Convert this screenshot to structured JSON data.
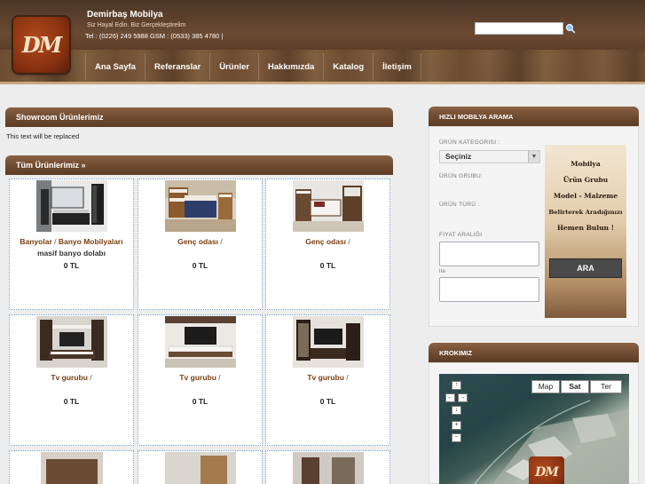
{
  "header": {
    "brand": "Demirbaş Mobilya",
    "slogan": "Siz Hayal Edin. Biz Gerçekleştirelim",
    "contact": "Tel : (0226) 249 5988 GSM : (0533) 385 4780 |",
    "logo_text": "DM",
    "search_placeholder": "",
    "search_icon": "search-icon"
  },
  "nav": [
    "Ana Sayfa",
    "Referanslar",
    "Ürünler",
    "Hakkımızda",
    "Katalog",
    "İletişim"
  ],
  "showroom": {
    "title": "Showroom Ürünlerimiz",
    "placeholder_text": "This text will be replaced"
  },
  "all_products": {
    "title": "Tüm Ürünlerimiz  »",
    "items": [
      {
        "title": "Banyolar",
        "category": "Banyo Mobilyaları",
        "subtitle": "masif banyo dolabı",
        "price": "0 TL"
      },
      {
        "title": "Genç odası",
        "category": "",
        "subtitle": "",
        "price": "0 TL"
      },
      {
        "title": "Genç odası",
        "category": "",
        "subtitle": "",
        "price": "0 TL"
      },
      {
        "title": "Tv gurubu",
        "category": "",
        "subtitle": "",
        "price": "0 TL"
      },
      {
        "title": "Tv gurubu",
        "category": "",
        "subtitle": "",
        "price": "0 TL"
      },
      {
        "title": "Tv gurubu",
        "category": "",
        "subtitle": "",
        "price": "0 TL"
      }
    ]
  },
  "search_panel": {
    "title": "HIZLI MOBILYA ARAMA",
    "category_label": "ÜRÜN KATEGORISI :",
    "category_value": "Seçiniz",
    "group_label": "ÜRÜN GRUBU:",
    "type_label": "ÜRÜN TÜRÜ :",
    "price_label": "FIYAT ARALIĞI",
    "between_label": "ile",
    "search_button": "ARA",
    "promo_lines": [
      "Mobilya",
      "Ürün Grubu",
      "Model - Malzeme",
      "Belirterek Aradığınızı",
      "Hemen Bulun !"
    ]
  },
  "map_panel": {
    "title": "KROKIMIZ",
    "types": [
      "Map",
      "Sat",
      "Ter"
    ],
    "active_type": "Sat",
    "controls": [
      "↑",
      "←",
      "→",
      "↓",
      "+",
      "−"
    ],
    "logo_text": "DM"
  },
  "colors": {
    "header_brown": "#6b4a33",
    "bar_brown": "#6e4a30",
    "product_title": "#7b3d12",
    "card_border": "#7aa0c4"
  }
}
